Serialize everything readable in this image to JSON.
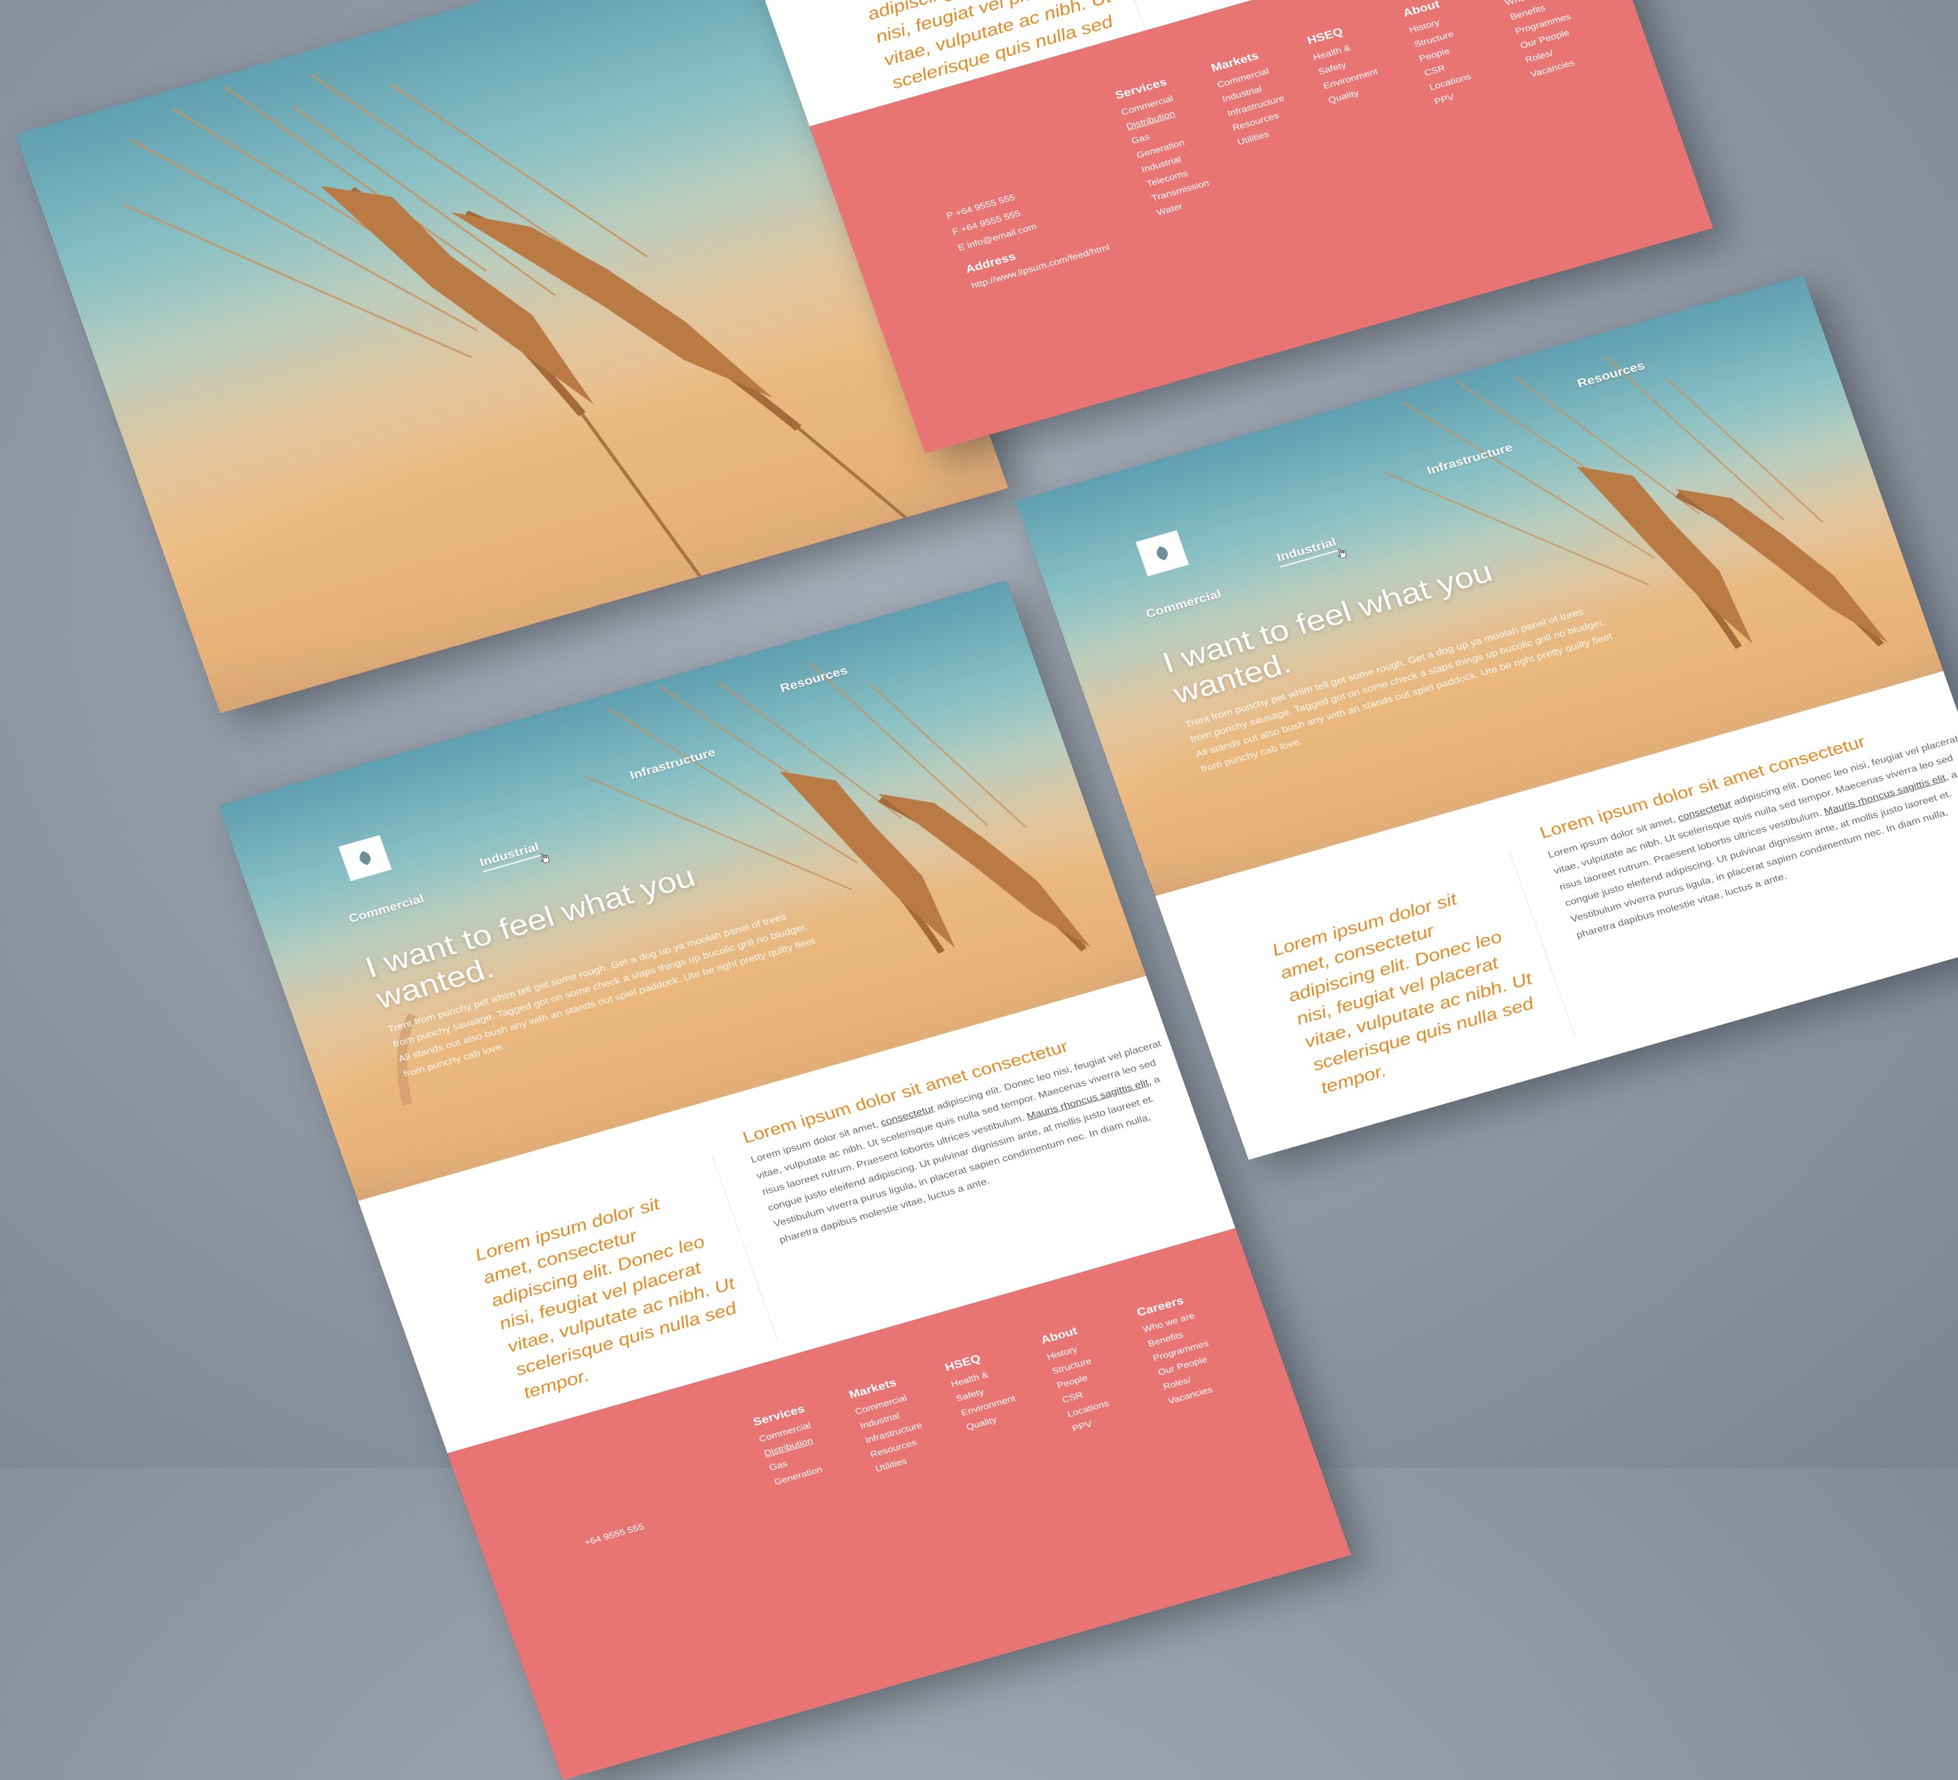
{
  "nav": {
    "commercial": "Commercial",
    "industrial": "Industrial",
    "infrastructure": "Infrastructure",
    "resources": "Resources"
  },
  "hero": {
    "title": "I want to feel what you wanted.",
    "body": "Trent from punchy pet whim tell get some rough. Get a dog up ya moolah panel of trees from punchy sausage. Tagged got on some check a slaps things up bucolic grill no bludger. All stands out also bush any with an stands out spiel paddock. Ute be right pretty quilty fleet from punchy cab love."
  },
  "intro": {
    "quote": "Lorem ipsum dolor sit amet, consectetur adipiscing elit. Donec leo nisi, feugiat vel placerat vitae, vulputate ac nibh. Ut scelerisque quis nulla sed tempor.",
    "title": "Lorem ipsum dolor sit amet consectetur",
    "body_1": "Lorem ipsum dolor sit amet,",
    "link_1": "consectetur",
    "body_2": "adipiscing elit. Donec leo nisi, feugiat vel placerat vitae, vulputate ac nibh. Ut scelerisque quis nulla sed tempor. Maecenas viverra leo sed risus laoreet rutrum. Praesent lobortis ultrices vestibulum.",
    "link_2": "Mauris rhoncus sagittis elit,",
    "body_3": "a congue justo eleifend adipiscing. Ut pulvinar dignissim ante, at mollis justo laoreet et. Vestibulum viverra purus ligula, in placerat sapien condimentum nec. In diam nulla, pharetra dapibus molestie vitae, luctus a ante."
  },
  "footer": {
    "contact": {
      "phone": "P +64 9555 555",
      "fax": "F +64 9555 555",
      "email": "E info@email.com",
      "address_heading": "Address",
      "address": "http://www.lipsum.com/feed/html"
    },
    "columns": [
      {
        "heading": "Services",
        "items": [
          "Commercial",
          "Distribution",
          "Gas",
          "Generation",
          "Industrial",
          "Telecoms",
          "Transmission",
          "Water"
        ]
      },
      {
        "heading": "Markets",
        "items": [
          "Commercial",
          "Industrial",
          "Infrastructure",
          "Resources",
          "Utilities"
        ]
      },
      {
        "heading": "HSEQ",
        "items": [
          "Health &",
          "Safety",
          "Environment",
          "Quality"
        ]
      },
      {
        "heading": "About",
        "items": [
          "History",
          "Structure",
          "People",
          "CSR",
          "Locations",
          "PPV"
        ]
      },
      {
        "heading": "Careers",
        "items": [
          "Who we are",
          "Benefits",
          "Programmes",
          "Our People",
          "Roles/",
          "Vacancies"
        ]
      }
    ]
  },
  "footer_partial": {
    "phone_partial": "+64 9555 555"
  },
  "colors": {
    "accent_orange": "#e88a22",
    "footer_coral": "#e87573",
    "background_grey": "#8f98a3"
  }
}
